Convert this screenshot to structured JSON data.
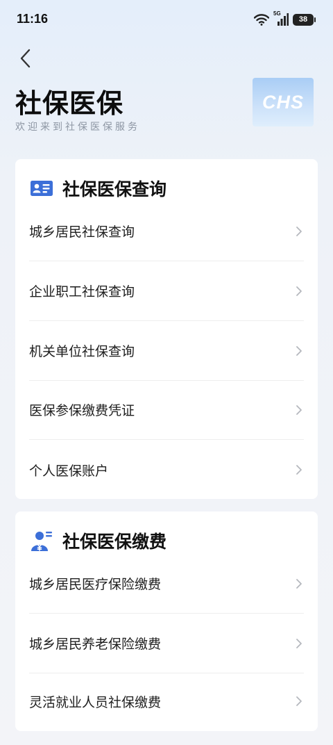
{
  "status_bar": {
    "time": "11:16",
    "network": "5G",
    "battery": "38"
  },
  "header": {
    "title": "社保医保",
    "subtitle": "欢迎来到社保医保服务",
    "logo_text": "CHS"
  },
  "sections": [
    {
      "title": "社保医保查询",
      "icon": "id-card-icon",
      "items": [
        "城乡居民社保查询",
        "企业职工社保查询",
        "机关单位社保查询",
        "医保参保缴费凭证",
        "个人医保账户"
      ]
    },
    {
      "title": "社保医保缴费",
      "icon": "user-payment-icon",
      "items": [
        "城乡居民医疗保险缴费",
        "城乡居民养老保险缴费",
        "灵活就业人员社保缴费"
      ]
    }
  ],
  "colors": {
    "accent": "#3c6fd8",
    "logo_text": "#ffffff",
    "subtitle": "#8d96a3",
    "chevron": "#b5b8be"
  }
}
